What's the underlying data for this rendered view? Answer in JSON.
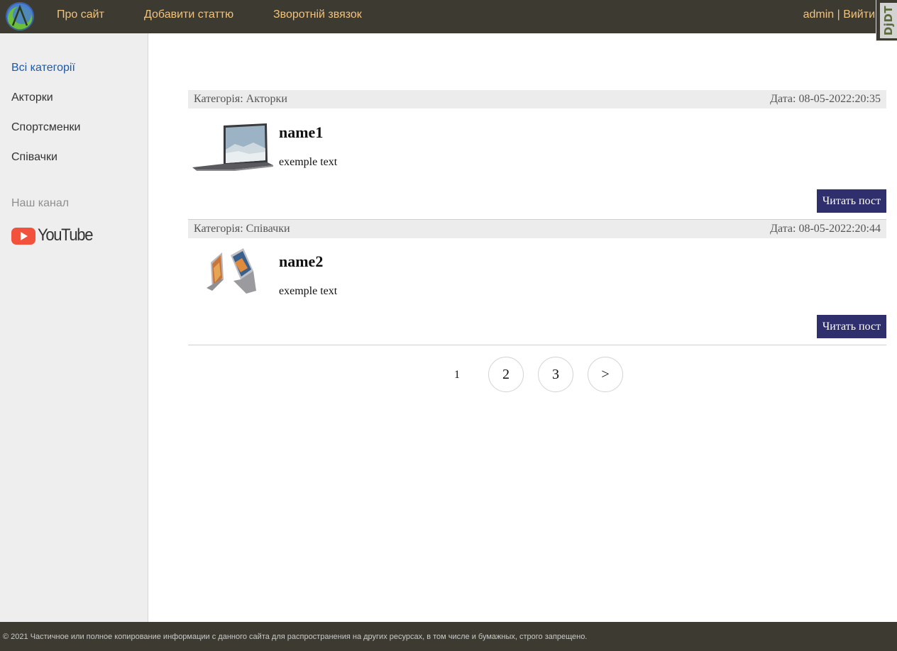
{
  "header": {
    "nav": [
      {
        "label": "Про сайт"
      },
      {
        "label": "Добавити статтю"
      },
      {
        "label": "Зворотній звязок"
      }
    ],
    "user": {
      "name": "admin",
      "separator": " | ",
      "logout": "Вийти"
    },
    "debug_toolbar": "DjDT"
  },
  "sidebar": {
    "categories": [
      {
        "label": "Всі категорії",
        "active": true
      },
      {
        "label": "Акторки"
      },
      {
        "label": "Спортсменки"
      },
      {
        "label": "Співачки"
      }
    ],
    "channel_heading": "Наш канал",
    "youtube_label": "YouTube"
  },
  "posts": [
    {
      "category": "Категорія: Акторки",
      "date": "Дата: 08-05-2022:20:35",
      "title": "name1",
      "text": "exemple text",
      "button": "Читать пост",
      "thumbnail": "laptop-image"
    },
    {
      "category": "Категорія: Співачки",
      "date": "Дата: 08-05-2022:20:44",
      "title": "name2",
      "text": "exemple text",
      "button": "Читать пост",
      "thumbnail": "laptops-image"
    }
  ],
  "pagination": {
    "current": "1",
    "pages": [
      "2",
      "3"
    ],
    "next": ">"
  },
  "footer": {
    "text": "© 2021 Частичное или полное копирование информации с данного сайта для распространения на других ресурсах, в том числе и бумажных, строго запрещено."
  },
  "colors": {
    "header_bg": "#3d3b31",
    "nav_link": "#f1c27d",
    "sidebar_bg": "#eeeeee",
    "active_link": "#1d5aa7",
    "button_bg": "#2f2f6e",
    "youtube_red": "#f2513b"
  }
}
